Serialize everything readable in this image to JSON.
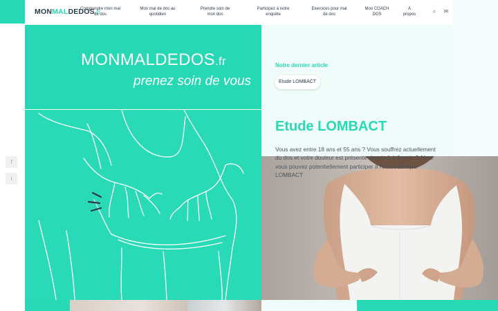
{
  "brand": {
    "part1": "MON",
    "part2": "MAL",
    "part3": "DEDOS",
    "part4": ".fr"
  },
  "nav": {
    "items": [
      {
        "label_line1": "Comprendre mon mal",
        "label_line2": "de dos"
      },
      {
        "label_line1": "Mon mal de dos au",
        "label_line2": "quotidien"
      },
      {
        "label_line1": "Prendre soin de",
        "label_line2": "mon dos"
      },
      {
        "label_line1": "Participez à notre",
        "label_line2": "enquête"
      },
      {
        "label_line1": "Exercices pour mal",
        "label_line2": "de dos"
      },
      {
        "label_line1": "Mon COACH",
        "label_line2": "DOS"
      },
      {
        "label_line1": "A",
        "label_line2": "propos"
      }
    ],
    "search_icon": "⌕",
    "mail_icon": "✉"
  },
  "hero": {
    "title": "MONMALDEDOS",
    "title_suffix": ".fr",
    "tagline": "prenez soin de vous"
  },
  "article": {
    "section_label": "Notre dernier article",
    "tag": "Etude LOMBACT",
    "title": "Etude LOMBACT",
    "description": "Vous avez entre 18 ans et 55 ans ? Vous souffrez actuellement du dos et votre douleur est présente depuis 1 à 6 mois ? Alors vous pouvez potentiellement participer à l'étude clinique LOMBACT"
  },
  "social": {
    "facebook": "f",
    "twitter": "t"
  },
  "colors": {
    "accent": "#28d9b5",
    "text": "#2d3a4a",
    "mint_bg": "#f0fcf9"
  }
}
